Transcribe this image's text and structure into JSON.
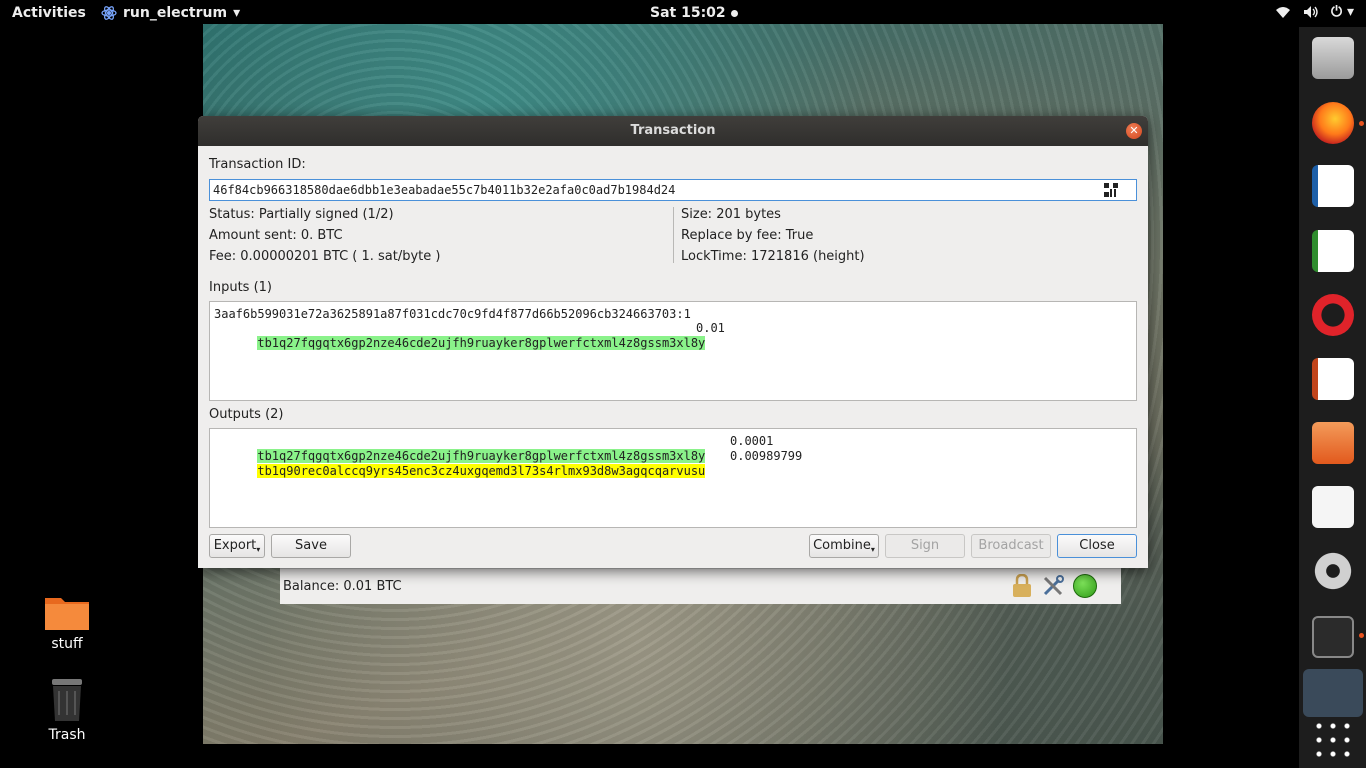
{
  "topbar": {
    "activities": "Activities",
    "app_name": "run_electrum",
    "clock": "Sat 15:02"
  },
  "desktop": {
    "icons": [
      {
        "label": "stuff"
      },
      {
        "label": "Trash"
      }
    ]
  },
  "main_window": {
    "balance": "Balance: 0.01 BTC"
  },
  "dialog": {
    "title": "Transaction",
    "txid_label": "Transaction ID:",
    "txid": "46f84cb966318580dae6dbb1e3eabadae55c7b4011b32e2afa0c0ad7b1984d24",
    "status": "Status: Partially signed (1/2)",
    "amount_sent": "Amount sent: 0. BTC",
    "fee": "Fee: 0.00000201 BTC  ( 1. sat/byte )",
    "size": "Size: 201 bytes",
    "rbf": "Replace by fee: True",
    "locktime": "LockTime: 1721816 (height)",
    "inputs_label": "Inputs (1)",
    "inputs": {
      "prevout": "3aaf6b599031e72a3625891a87f031cdc70c9fd4f877d66b52096cb324663703:1",
      "address": "tb1q27fqgqtx6gp2nze46cde2ujfh9ruayker8gplwerfctxml4z8gssm3xl8y",
      "amount": "0.01"
    },
    "outputs_label": "Outputs (2)",
    "outputs": [
      {
        "address": "tb1q27fqgqtx6gp2nze46cde2ujfh9ruayker8gplwerfctxml4z8gssm3xl8y",
        "amount": "0.0001",
        "color": "#8af28a"
      },
      {
        "address": "tb1q90rec0alccq9yrs45enc3cz4uxgqemd3l73s4rlmx93d8w3agqcqarvusu",
        "amount": "0.00989799",
        "color": "#ffff00"
      }
    ],
    "buttons": {
      "export": "Export",
      "save": "Save",
      "combine": "Combine",
      "sign": "Sign",
      "broadcast": "Broadcast",
      "close": "Close"
    }
  },
  "dock": {
    "items": [
      "files-icon",
      "firefox-icon",
      "writer-icon",
      "calc-icon",
      "opera-icon",
      "impress-icon",
      "software-icon",
      "amazon-icon",
      "settings-icon",
      "terminal-icon",
      "electrum-icon",
      "app-grid-icon"
    ]
  }
}
